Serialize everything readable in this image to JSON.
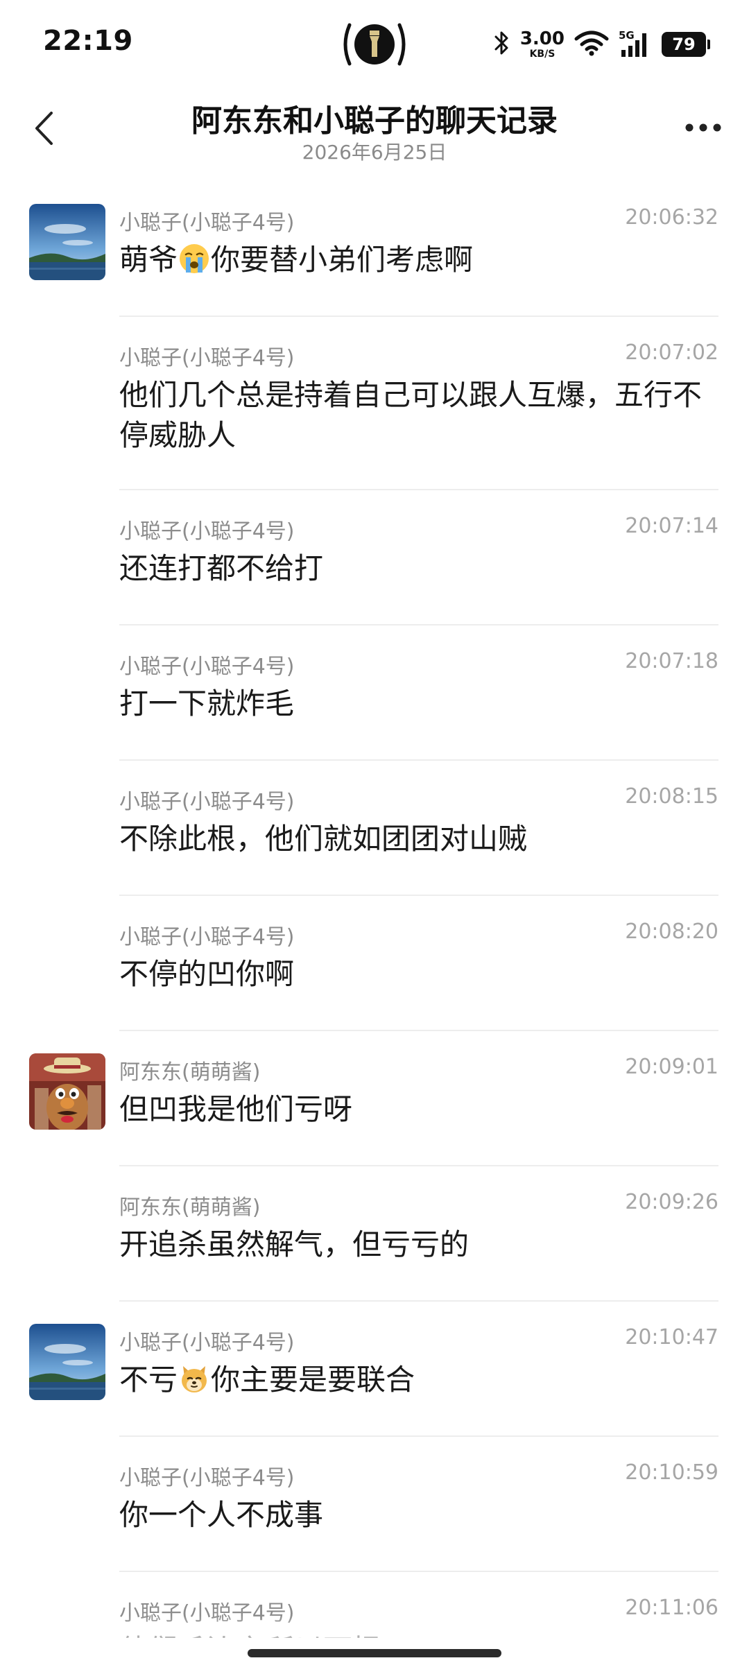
{
  "status_bar": {
    "time": "22:19",
    "net_speed": "3.00",
    "net_speed_unit": "KB/S",
    "signal_label": "5G",
    "battery": "79"
  },
  "header": {
    "title": "阿东东和小聪子的聊天记录",
    "date": "2026年6月25日"
  },
  "messages": [
    {
      "sender": "小聪子(小聪子4号)",
      "time": "20:06:32",
      "avatar": "landscape-avatar",
      "parts": [
        "萌爷",
        "😭",
        "你要替小弟们考虑啊"
      ]
    },
    {
      "sender": "小聪子(小聪子4号)",
      "time": "20:07:02",
      "avatar": "",
      "parts": [
        "他们几个总是持着自己可以跟人互爆，五行不停威胁人"
      ]
    },
    {
      "sender": "小聪子(小聪子4号)",
      "time": "20:07:14",
      "avatar": "",
      "parts": [
        "还连打都不给打"
      ]
    },
    {
      "sender": "小聪子(小聪子4号)",
      "time": "20:07:18",
      "avatar": "",
      "parts": [
        "打一下就炸毛"
      ]
    },
    {
      "sender": "小聪子(小聪子4号)",
      "time": "20:08:15",
      "avatar": "",
      "parts": [
        "不除此根，他们就如团团对山贼"
      ]
    },
    {
      "sender": "小聪子(小聪子4号)",
      "time": "20:08:20",
      "avatar": "",
      "parts": [
        "不停的凹你啊"
      ]
    },
    {
      "sender": "阿东东(萌萌酱)",
      "time": "20:09:01",
      "avatar": "potato-head-avatar",
      "parts": [
        "但凹我是他们亏呀"
      ]
    },
    {
      "sender": "阿东东(萌萌酱)",
      "time": "20:09:26",
      "avatar": "",
      "parts": [
        "开追杀虽然解气，但亏亏的"
      ]
    },
    {
      "sender": "小聪子(小聪子4号)",
      "time": "20:10:47",
      "avatar": "landscape-avatar",
      "parts": [
        "不亏",
        "🐶",
        "你主要是要联合"
      ]
    },
    {
      "sender": "小聪子(小聪子4号)",
      "time": "20:10:59",
      "avatar": "",
      "parts": [
        "你一个人不成事"
      ]
    },
    {
      "sender": "小聪子(小聪子4号)",
      "time": "20:11:06",
      "avatar": "",
      "parts": [
        "他们毛边之所以可恨"
      ]
    }
  ],
  "colors": {
    "sender": "#8c8c8c",
    "timestamp": "#a6a6a6",
    "divider": "#ededed"
  },
  "icons": {
    "back": "chevron-left-icon",
    "more": "more-dots-icon",
    "flashlight": "flashlight-icon",
    "bluetooth": "bluetooth-icon",
    "wifi": "wifi-icon",
    "signal": "cellular-signal-icon",
    "battery": "battery-icon"
  }
}
